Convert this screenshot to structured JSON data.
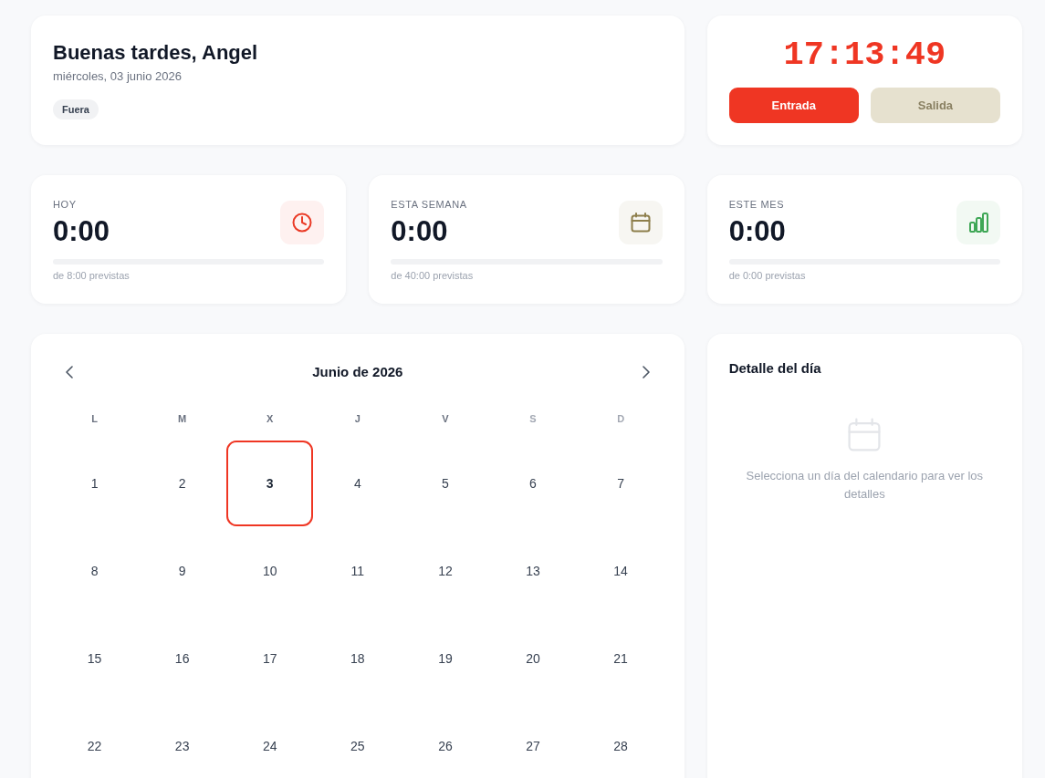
{
  "greeting": {
    "title": "Buenas tardes, Angel",
    "date": "miércoles, 03 junio 2026",
    "status": "Fuera"
  },
  "clock": {
    "time": "17:13:49",
    "buttons": [
      {
        "label": "Entrada",
        "disabled": false
      },
      {
        "label": "Salida",
        "disabled": true
      }
    ]
  },
  "stats": [
    {
      "label": "HOY",
      "value": "0:00",
      "caption": "de 8:00 previstas",
      "level": 0,
      "kind": "clock",
      "color": "#ea3a26"
    },
    {
      "label": "ESTA SEMANA",
      "value": "0:00",
      "caption": "de 40:00 previstas",
      "level": 0,
      "kind": "calendar",
      "color": "#8e7f4c"
    },
    {
      "label": "ESTE MES",
      "value": "0:00",
      "caption": "de 0:00 previstas",
      "level": 0,
      "kind": "chart",
      "color": "#3fa756"
    }
  ],
  "calendar": {
    "title": "Junio de 2026",
    "weekdays": [
      {
        "label": "L",
        "weekend": false
      },
      {
        "label": "M",
        "weekend": false
      },
      {
        "label": "X",
        "weekend": false
      },
      {
        "label": "J",
        "weekend": false
      },
      {
        "label": "V",
        "weekend": false
      },
      {
        "label": "S",
        "weekend": true
      },
      {
        "label": "D",
        "weekend": true
      }
    ],
    "days": [
      {
        "label": "1",
        "selected": false
      },
      {
        "label": "2",
        "selected": false
      },
      {
        "label": "3",
        "selected": true
      },
      {
        "label": "4",
        "selected": false
      },
      {
        "label": "5",
        "selected": false
      },
      {
        "label": "6",
        "selected": false
      },
      {
        "label": "7",
        "selected": false
      },
      {
        "label": "8",
        "selected": false
      },
      {
        "label": "9",
        "selected": false
      },
      {
        "label": "10",
        "selected": false
      },
      {
        "label": "11",
        "selected": false
      },
      {
        "label": "12",
        "selected": false
      },
      {
        "label": "13",
        "selected": false
      },
      {
        "label": "14",
        "selected": false
      },
      {
        "label": "15",
        "selected": false
      },
      {
        "label": "16",
        "selected": false
      },
      {
        "label": "17",
        "selected": false
      },
      {
        "label": "18",
        "selected": false
      },
      {
        "label": "19",
        "selected": false
      },
      {
        "label": "20",
        "selected": false
      },
      {
        "label": "21",
        "selected": false
      },
      {
        "label": "22",
        "selected": false
      },
      {
        "label": "23",
        "selected": false
      },
      {
        "label": "24",
        "selected": false
      },
      {
        "label": "25",
        "selected": false
      },
      {
        "label": "26",
        "selected": false
      },
      {
        "label": "27",
        "selected": false
      },
      {
        "label": "28",
        "selected": false
      }
    ]
  },
  "detail": {
    "title": "Detalle del día",
    "empty_message": "Selecciona un día del calendario para ver los detalles"
  }
}
